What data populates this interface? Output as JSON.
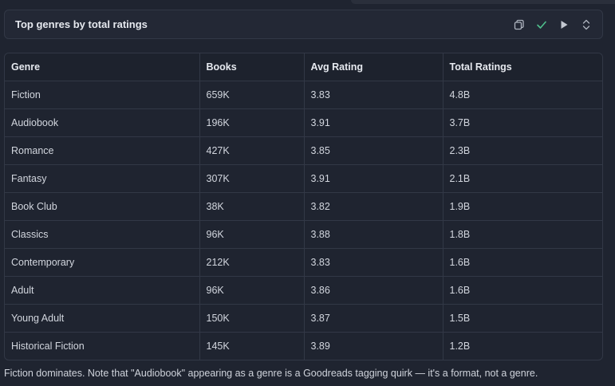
{
  "cell": {
    "title": "Top genres by total ratings",
    "toolbar": {
      "copy_icon": "copy-icon",
      "check_icon": "check-icon",
      "run_icon": "play-icon",
      "expand_icon": "chevron-up-down-icon"
    }
  },
  "table": {
    "columns": [
      "Genre",
      "Books",
      "Avg Rating",
      "Total Ratings"
    ],
    "rows": [
      [
        "Fiction",
        "659K",
        "3.83",
        "4.8B"
      ],
      [
        "Audiobook",
        "196K",
        "3.91",
        "3.7B"
      ],
      [
        "Romance",
        "427K",
        "3.85",
        "2.3B"
      ],
      [
        "Fantasy",
        "307K",
        "3.91",
        "2.1B"
      ],
      [
        "Book Club",
        "38K",
        "3.82",
        "1.9B"
      ],
      [
        "Classics",
        "96K",
        "3.88",
        "1.8B"
      ],
      [
        "Contemporary",
        "212K",
        "3.83",
        "1.6B"
      ],
      [
        "Adult",
        "96K",
        "3.86",
        "1.6B"
      ],
      [
        "Young Adult",
        "150K",
        "3.87",
        "1.5B"
      ],
      [
        "Historical Fiction",
        "145K",
        "3.89",
        "1.2B"
      ]
    ]
  },
  "footnote": "Fiction dominates. Note that \"Audiobook\" appearing as a genre is a Goodreads tagging quirk — it's a format, not a genre.",
  "colors": {
    "background": "#1f2430",
    "check_accent": "#4fc08d"
  }
}
